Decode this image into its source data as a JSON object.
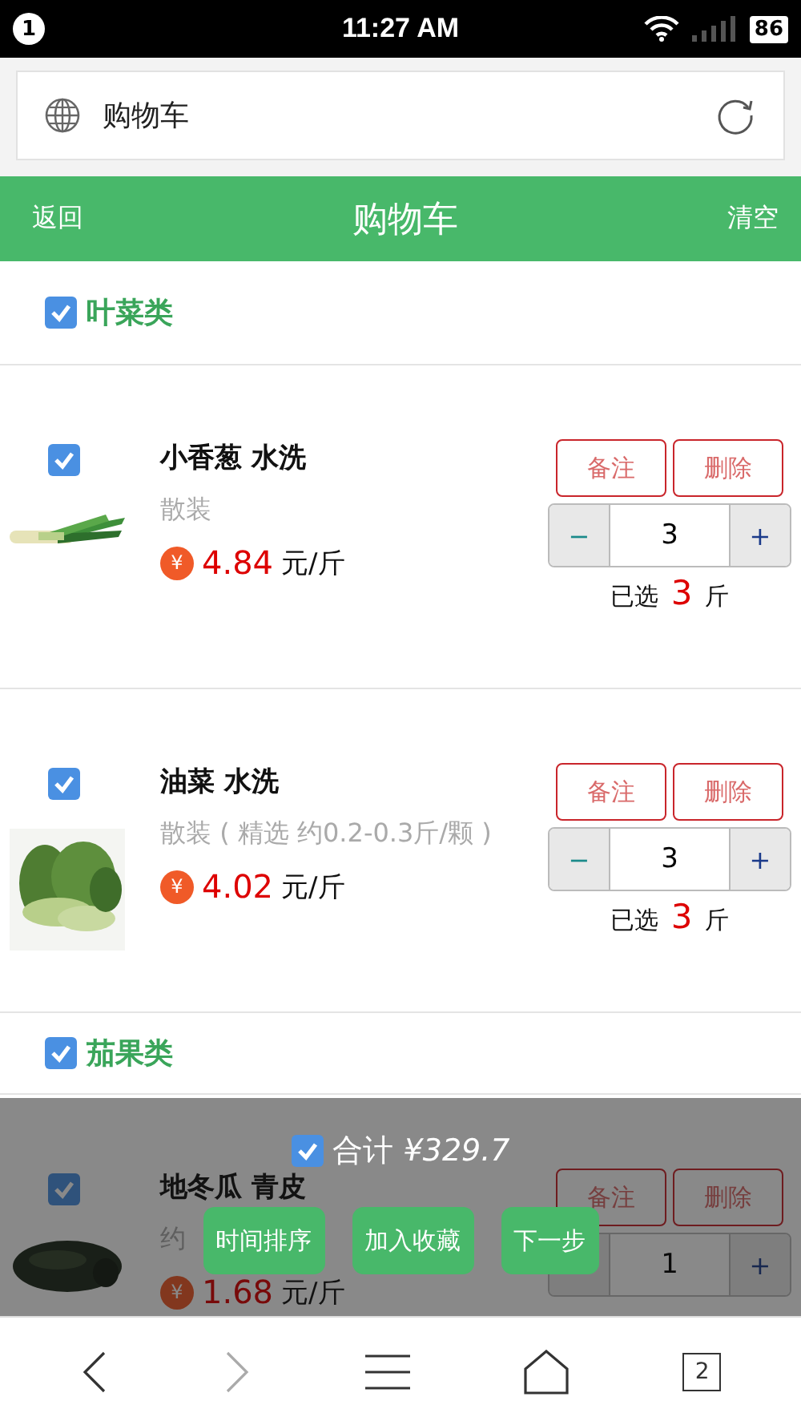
{
  "status_bar": {
    "notification_count": "1",
    "time": "11:27 AM",
    "battery": "86"
  },
  "address_bar": {
    "title": "购物车"
  },
  "header": {
    "back": "返回",
    "title": "购物车",
    "clear": "清空"
  },
  "groups": [
    {
      "name": "叶菜类",
      "checked": true,
      "items": [
        {
          "kind": "picture",
          "checked": true,
          "name": "小香葱 水洗",
          "spec": "散装",
          "currency": "¥",
          "price": "4.84",
          "unit": "元/斤",
          "note": "备注",
          "delete": "删除",
          "minus": "−",
          "quantity": "3",
          "plus": "+",
          "selected_label": "已选",
          "selected_count": "3",
          "selected_unit": "斤"
        },
        {
          "kind": "picture",
          "checked": true,
          "name": "油菜 水洗",
          "spec": "散装 ( 精选 约0.2-0.3斤/颗 )",
          "currency": "¥",
          "price": "4.02",
          "unit": "元/斤",
          "note": "备注",
          "delete": "删除",
          "minus": "−",
          "quantity": "3",
          "plus": "+",
          "selected_label": "已选",
          "selected_count": "3",
          "selected_unit": "斤"
        }
      ]
    },
    {
      "name": "茄果类",
      "checked": true,
      "items": [
        {
          "kind": "picture",
          "checked": true,
          "name": "地冬瓜 青皮",
          "spec": "约",
          "currency": "¥",
          "price": "1.68",
          "unit": "元/斤",
          "note": "备注",
          "delete": "删除",
          "quantity": "1",
          "plus": "+"
        }
      ]
    }
  ],
  "footer": {
    "checked": true,
    "total": "合计 *¥329.7*",
    "buttons": [
      "时间排序",
      "加入收藏",
      "下一步"
    ]
  },
  "bottom_nav": {
    "forward_disabled": true,
    "tabs_count": "2"
  }
}
